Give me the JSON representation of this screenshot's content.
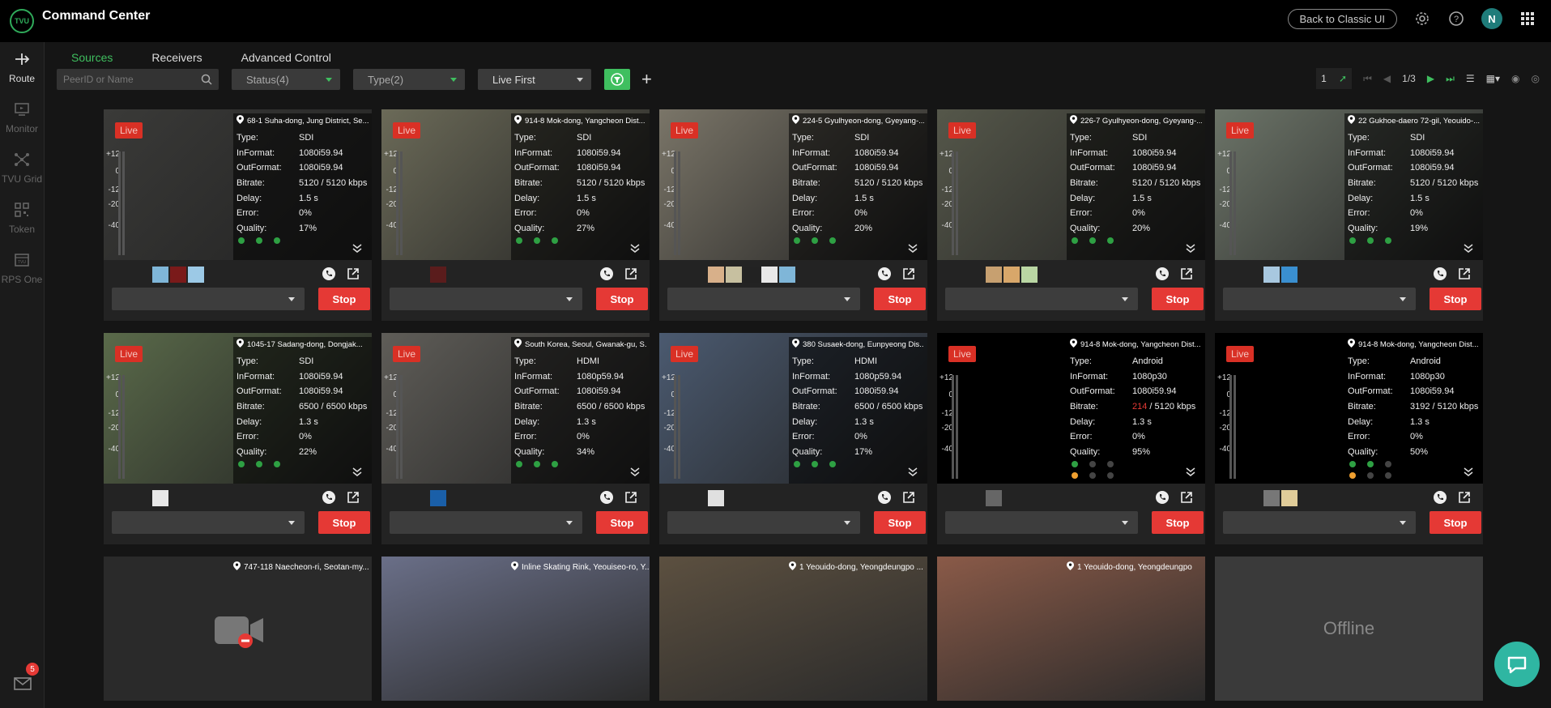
{
  "app": {
    "title": "Command Center",
    "logo_text": "TVU"
  },
  "topbar": {
    "classic_button": "Back to Classic UI",
    "avatar_initial": "N"
  },
  "sidebar": {
    "items": [
      {
        "label": "Route",
        "icon": "route-icon",
        "active": true
      },
      {
        "label": "Monitor",
        "icon": "monitor-icon",
        "active": false
      },
      {
        "label": "TVU Grid",
        "icon": "grid-network-icon",
        "active": false
      },
      {
        "label": "Token",
        "icon": "qr-code-icon",
        "active": false
      },
      {
        "label": "RPS One",
        "icon": "rps-icon",
        "active": false
      }
    ],
    "mail_badge": "5"
  },
  "tabs": [
    {
      "label": "Sources",
      "active": true
    },
    {
      "label": "Receivers",
      "active": false
    },
    {
      "label": "Advanced Control",
      "active": false
    }
  ],
  "filters": {
    "search_placeholder": "PeerID or Name",
    "status": "Status(4)",
    "type": "Type(2)",
    "sort": "Live First"
  },
  "pager": {
    "page_input": "1",
    "page_of": "1/3"
  },
  "cards": [
    {
      "live": "Live",
      "location": "68-1 Suha-dong, Jung District, Se...",
      "type": "SDI",
      "informat": "1080i59.94",
      "outformat": "1080i59.94",
      "bitrate": "5120 / 5120 kbps",
      "delay": "1.5 s",
      "error": "0%",
      "quality": "17%",
      "bg": "#3a3a38",
      "dots": [
        "green",
        "green",
        "green"
      ],
      "swatches": [
        "#7fb6d8",
        "#7a1a1a",
        "#9cc9e6"
      ],
      "stop": "Stop"
    },
    {
      "live": "Live",
      "location": "914-8 Mok-dong, Yangcheon Dist...",
      "type": "SDI",
      "informat": "1080i59.94",
      "outformat": "1080i59.94",
      "bitrate": "5120 / 5120 kbps",
      "delay": "1.5 s",
      "error": "0%",
      "quality": "27%",
      "bg": "#6b6a58",
      "dots": [
        "green",
        "green",
        "green"
      ],
      "swatches": [
        "#5a1c1c"
      ],
      "stop": "Stop"
    },
    {
      "live": "Live",
      "location": "224-5 Gyulhyeon-dong, Gyeyang-...",
      "type": "SDI",
      "informat": "1080i59.94",
      "outformat": "1080i59.94",
      "bitrate": "5120 / 5120 kbps",
      "delay": "1.5 s",
      "error": "0%",
      "quality": "20%",
      "bg": "#7a7568",
      "dots": [
        "green",
        "green",
        "green"
      ],
      "swatches": [
        "#d8b08a",
        "#c7c0a0",
        "#222",
        "#e8e8e8",
        "#7fb6d8"
      ],
      "stop": "Stop"
    },
    {
      "live": "Live",
      "location": "226-7 Gyulhyeon-dong, Gyeyang-...",
      "type": "SDI",
      "informat": "1080i59.94",
      "outformat": "1080i59.94",
      "bitrate": "5120 / 5120 kbps",
      "delay": "1.5 s",
      "error": "0%",
      "quality": "20%",
      "bg": "#55574a",
      "dots": [
        "green",
        "green",
        "green"
      ],
      "swatches": [
        "#c7a070",
        "#d8a76a",
        "#b9d6a3"
      ],
      "stop": "Stop"
    },
    {
      "live": "Live",
      "location": "22 Gukhoe-daero 72-gil, Yeouido-...",
      "type": "SDI",
      "informat": "1080i59.94",
      "outformat": "1080i59.94",
      "bitrate": "5120 / 5120 kbps",
      "delay": "1.5 s",
      "error": "0%",
      "quality": "19%",
      "bg": "#6c7468",
      "dots": [
        "green",
        "green",
        "green"
      ],
      "swatches": [
        "#a8c8e0",
        "#3a8fd0"
      ],
      "stop": "Stop"
    },
    {
      "live": "Live",
      "location": "1045-17 Sadang-dong, Dongjak...",
      "type": "SDI",
      "informat": "1080i59.94",
      "outformat": "1080i59.94",
      "bitrate": "6500 / 6500 kbps",
      "delay": "1.3 s",
      "error": "0%",
      "quality": "22%",
      "bg": "#5a6a4a",
      "dots": [
        "green",
        "green",
        "green"
      ],
      "swatches": [
        "#e8e8e8"
      ],
      "stop": "Stop"
    },
    {
      "live": "Live",
      "location": "South Korea, Seoul, Gwanak-gu, S...",
      "type": "HDMI",
      "informat": "1080p59.94",
      "outformat": "1080i59.94",
      "bitrate": "6500 / 6500 kbps",
      "delay": "1.3 s",
      "error": "0%",
      "quality": "34%",
      "bg": "#5f5d58",
      "dots": [
        "green",
        "green",
        "green"
      ],
      "swatches": [
        "#1a5fa8"
      ],
      "stop": "Stop"
    },
    {
      "live": "Live",
      "location": "380 Susaek-dong, Eunpyeong Dis...",
      "type": "HDMI",
      "informat": "1080p59.94",
      "outformat": "1080i59.94",
      "bitrate": "6500 / 6500 kbps",
      "delay": "1.3 s",
      "error": "0%",
      "quality": "17%",
      "bg": "#4b5a70",
      "dots": [
        "green",
        "green",
        "green"
      ],
      "swatches": [
        "#e0e0e0"
      ],
      "stop": "Stop"
    },
    {
      "live": "Live",
      "location": "914-8 Mok-dong, Yangcheon Dist...",
      "type": "Android",
      "informat": "1080p30",
      "outformat": "1080i59.94",
      "bitrate_alert": "214",
      "bitrate": " / 5120 kbps",
      "delay": "1.3 s",
      "error": "0%",
      "quality": "95%",
      "bg": "#000000",
      "dots": [
        "green",
        "gray",
        "gray",
        "orange",
        "gray",
        "gray"
      ],
      "swatches": [
        "#666"
      ],
      "stop": "Stop"
    },
    {
      "live": "Live",
      "location": "914-8 Mok-dong, Yangcheon Dist...",
      "type": "Android",
      "informat": "1080p30",
      "outformat": "1080i59.94",
      "bitrate": "3192 / 5120 kbps",
      "delay": "1.3 s",
      "error": "0%",
      "quality": "50%",
      "bg": "#000000",
      "dots": [
        "green",
        "green",
        "gray",
        "orange",
        "gray",
        "gray"
      ],
      "swatches": [
        "#777",
        "#e0cc99"
      ],
      "stop": "Stop"
    }
  ],
  "bottom_cards": [
    {
      "location": "747-118 Naecheon-ri, Seotan-my...",
      "kind": "camera-off"
    },
    {
      "location": "Inline Skating Rink, Yeouiseo-ro, Y...",
      "kind": "image",
      "bg": "#6a6f88"
    },
    {
      "location": "1 Yeouido-dong, Yeongdeungpo ...",
      "kind": "image",
      "bg": "#5c5040"
    },
    {
      "location": "1 Yeouido-dong, Yeongdeungpo",
      "kind": "image",
      "bg": "#8a5a48"
    },
    {
      "kind": "offline",
      "label": "Offline"
    }
  ],
  "labels": {
    "type": "Type:",
    "informat": "InFormat:",
    "outformat": "OutFormat:",
    "bitrate": "Bitrate:",
    "delay": "Delay:",
    "error": "Error:",
    "quality": "Quality:"
  },
  "meter_ticks": [
    "+12",
    "0",
    "-12",
    "-20",
    "-40"
  ]
}
